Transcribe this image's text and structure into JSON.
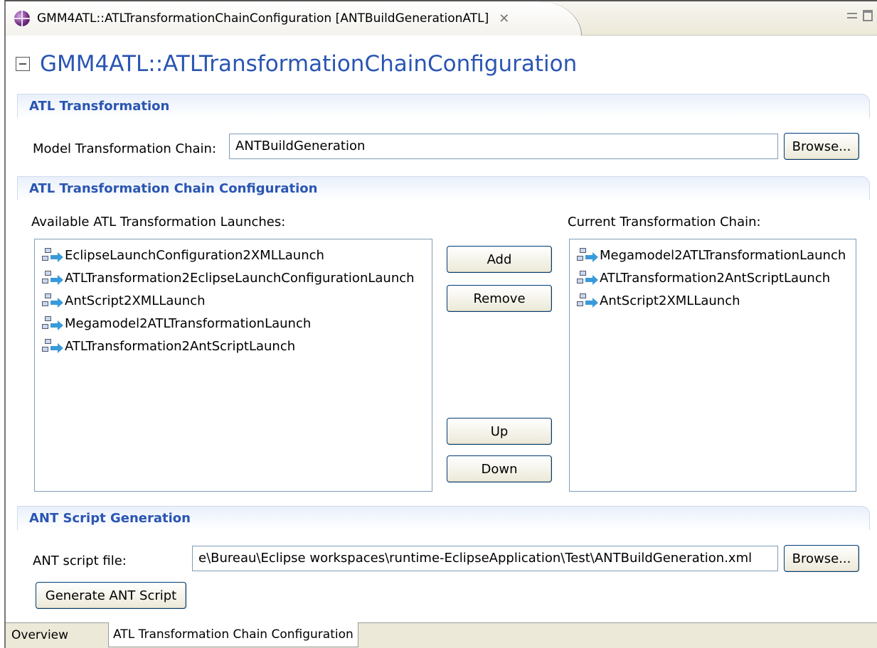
{
  "editor_tab": {
    "title": "GMM4ATL::ATLTransformationChainConfiguration [ANTBuildGenerationATL]",
    "close_glyph": "✕"
  },
  "page": {
    "title": "GMM4ATL::ATLTransformationChainConfiguration"
  },
  "atl_transformation": {
    "heading": "ATL Transformation",
    "chain_label": "Model Transformation Chain:",
    "chain_value": "ANTBuildGeneration",
    "browse_label": "Browse..."
  },
  "chain_config": {
    "heading": "ATL Transformation Chain Configuration",
    "available_label": "Available ATL Transformation Launches:",
    "current_label": "Current Transformation Chain:",
    "available_items": [
      "EclipseLaunchConfiguration2XMLLaunch",
      "ATLTransformation2EclipseLaunchConfigurationLaunch",
      "AntScript2XMLLaunch",
      "Megamodel2ATLTransformationLaunch",
      "ATLTransformation2AntScriptLaunch"
    ],
    "current_items": [
      "Megamodel2ATLTransformationLaunch",
      "ATLTransformation2AntScriptLaunch",
      "AntScript2XMLLaunch"
    ],
    "add_label": "Add",
    "remove_label": "Remove",
    "up_label": "Up",
    "down_label": "Down"
  },
  "ant_script": {
    "heading": "ANT Script Generation",
    "file_label": "ANT script file:",
    "file_value": "e\\Bureau\\Eclipse workspaces\\runtime-EclipseApplication\\Test\\ANTBuildGeneration.xml",
    "browse_label": "Browse...",
    "generate_label": "Generate ANT Script"
  },
  "page_tabs": {
    "overview": "Overview",
    "chain_config": "ATL Transformation Chain Configuration"
  },
  "colors": {
    "accent": "#2a55b2",
    "section_bg": "#e9f0fb",
    "chrome": "#ece9d8"
  }
}
